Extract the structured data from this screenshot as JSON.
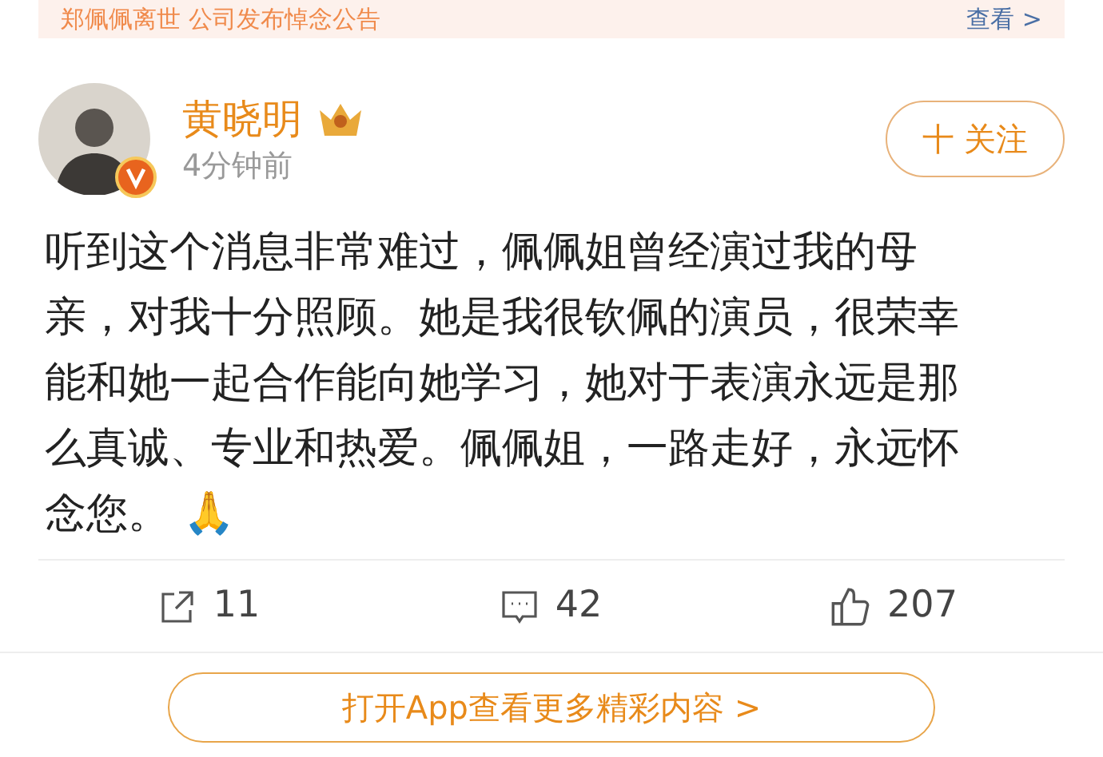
{
  "banner": {
    "text": "郑佩佩离世 公司发布悼念公告",
    "link": "查看 >"
  },
  "post": {
    "author": "黄晓明",
    "time": "4分钟前",
    "follow": "十 关注",
    "text": "听到这个消息非常难过，佩佩姐曾经演过我的母亲，对我十分照顾。她是我很钦佩的演员，很荣幸能和她一起合作能向她学习，她对于表演永远是那么真诚、专业和热爱。佩佩姐，一路走好，永远怀念您。 🙏"
  },
  "actions": [
    {
      "kind": "share",
      "count": "11"
    },
    {
      "kind": "comment",
      "count": "42"
    },
    {
      "kind": "like",
      "count": "207"
    }
  ],
  "open_app": "打开App查看更多精彩内容 >"
}
